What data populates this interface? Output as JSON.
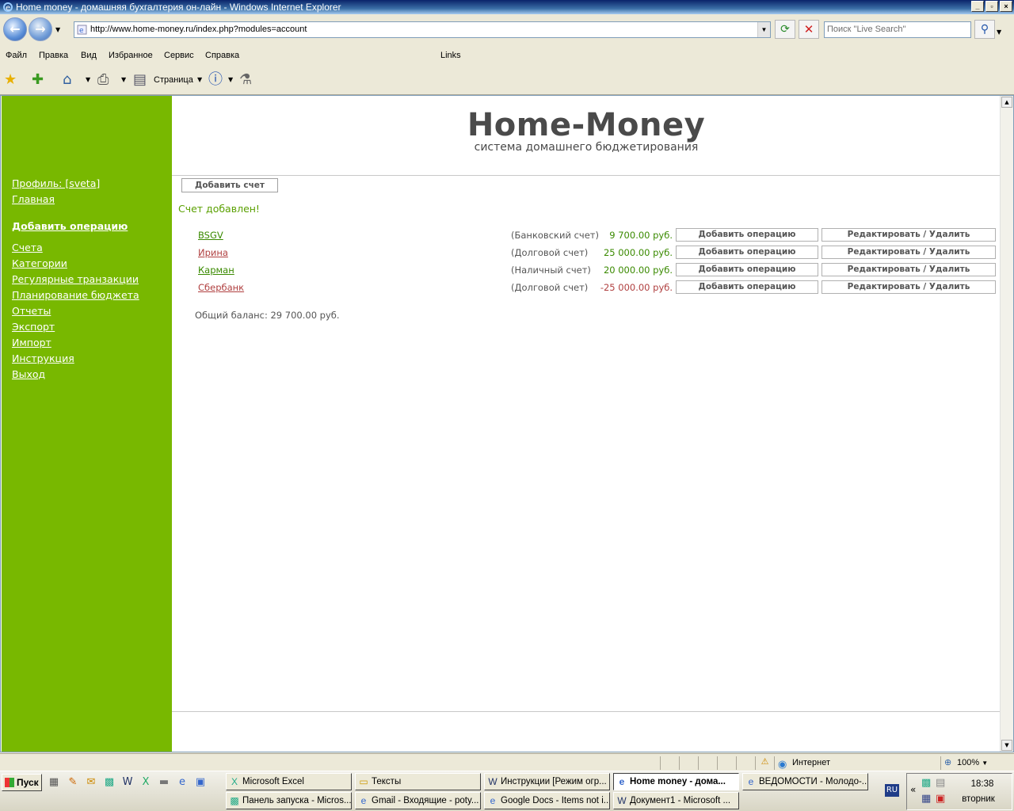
{
  "window": {
    "title": "Home money - домашняя бухгалтерия он-лайн - Windows Internet Explorer"
  },
  "address": {
    "url": "http://www.home-money.ru/index.php?modules=account",
    "search_placeholder": "Поиск \"Live Search\""
  },
  "menu": {
    "file": "Файл",
    "edit": "Правка",
    "view": "Вид",
    "favorites": "Избранное",
    "tools": "Сервис",
    "help": "Справка",
    "links": "Links"
  },
  "toolbar": {
    "page_label": "Страница"
  },
  "sidebar": {
    "profile": "Профиль: [sveta]",
    "home": "Главная",
    "add_operation": "Добавить операцию",
    "items": [
      "Счета",
      "Категории",
      "Регулярные транзакции",
      "Планирование бюджета",
      "Отчеты",
      "Экспорт",
      "Импорт",
      "Инструкция",
      "Выход"
    ]
  },
  "logo": {
    "title": "Home-Money",
    "subtitle": "система домашнего бюджетирования"
  },
  "main": {
    "add_account_button": "Добавить счет",
    "notice": "Счет добавлен!",
    "accounts": [
      {
        "name": "BSGV",
        "type": "(Банковский счет)",
        "amount": "9 700.00 руб.",
        "color": "#3a8a00"
      },
      {
        "name": "Ирина",
        "type": "(Долговой счет)",
        "amount": "25 000.00 руб.",
        "color": "#b04040"
      },
      {
        "name": "Карман",
        "type": "(Наличный счет)",
        "amount": "20 000.00 руб.",
        "color": "#3a8a00"
      },
      {
        "name": "Сбербанк",
        "type": "(Долговой счет)",
        "amount": "-25 000.00 руб.",
        "color": "#b04040"
      }
    ],
    "add_op_label": "Добавить операцию",
    "edit_label": "Редактировать / Удалить",
    "total": "Общий баланс: 29 700.00 руб."
  },
  "statusbar": {
    "zone": "Интернет",
    "zoom": "100%"
  },
  "taskbar": {
    "start": "Пуск",
    "tasks": [
      "Microsoft Excel",
      "Тексты",
      "Инструкции [Режим огр...",
      "Home money - дома...",
      "ВЕДОМОСТИ - Молодо-...",
      "Панель запуска - Micros...",
      "Gmail - Входящие - poty...",
      "Google Docs - Items not i...",
      "Документ1 - Microsoft ..."
    ],
    "lang": "RU",
    "time": "18:38",
    "day": "вторник"
  },
  "colors": {
    "sidebar": "#78b800",
    "notice": "#5aa000",
    "positive": "#3a8a00",
    "negative": "#b04040"
  }
}
